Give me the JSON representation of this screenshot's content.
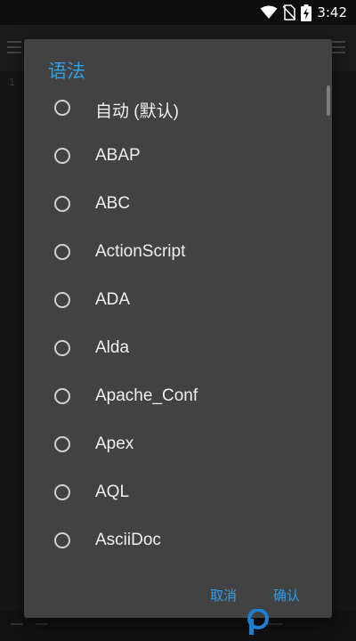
{
  "status_bar": {
    "time": "3:42",
    "icons": [
      "wifi-icon",
      "no-sim-icon",
      "battery-charging-icon"
    ]
  },
  "dialog": {
    "title": "语法",
    "options": [
      {
        "label": "自动 (默认)",
        "selected": false
      },
      {
        "label": "ABAP",
        "selected": false
      },
      {
        "label": "ABC",
        "selected": false
      },
      {
        "label": "ActionScript",
        "selected": false
      },
      {
        "label": "ADA",
        "selected": false
      },
      {
        "label": "Alda",
        "selected": false
      },
      {
        "label": "Apache_Conf",
        "selected": false
      },
      {
        "label": "Apex",
        "selected": false
      },
      {
        "label": "AQL",
        "selected": false
      },
      {
        "label": "AsciiDoc",
        "selected": false
      }
    ],
    "cancel_label": "取消",
    "confirm_label": "确认"
  },
  "background": {
    "line_number": "1"
  },
  "colors": {
    "accent": "#2e9fe6",
    "dialog_bg": "#424242",
    "text": "#f0f0f0"
  }
}
